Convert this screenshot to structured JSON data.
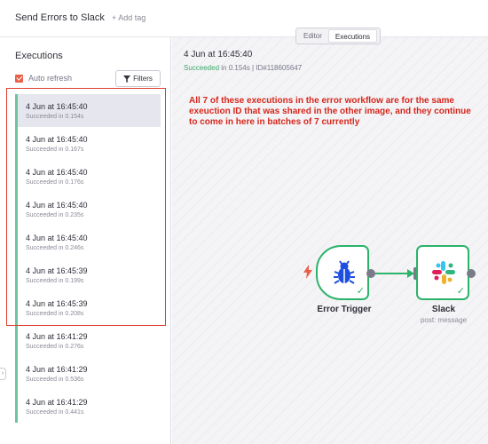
{
  "header": {
    "workflow_name": "Send Errors to Slack",
    "add_tag": "+ Add tag"
  },
  "view_toggle": {
    "editor": "Editor",
    "executions": "Executions",
    "active": "Executions"
  },
  "sidebar": {
    "title": "Executions",
    "auto_refresh": {
      "label": "Auto refresh",
      "checked": true
    },
    "filters_label": "Filters",
    "executions": [
      {
        "date": "4 Jun at 16:45:40",
        "status": "Succeeded in 0.154s",
        "selected": true
      },
      {
        "date": "4 Jun at 16:45:40",
        "status": "Succeeded in 0.167s"
      },
      {
        "date": "4 Jun at 16:45:40",
        "status": "Succeeded in 0.176s"
      },
      {
        "date": "4 Jun at 16:45:40",
        "status": "Succeeded in 0.235s"
      },
      {
        "date": "4 Jun at 16:45:40",
        "status": "Succeeded in 0.246s"
      },
      {
        "date": "4 Jun at 16:45:39",
        "status": "Succeeded in 0.199s"
      },
      {
        "date": "4 Jun at 16:45:39",
        "status": "Succeeded in 0.208s"
      },
      {
        "date": "4 Jun at 16:41:29",
        "status": "Succeeded in 0.276s"
      },
      {
        "date": "4 Jun at 16:41:29",
        "status": "Succeeded in 0.536s"
      },
      {
        "date": "4 Jun at 16:41:29",
        "status": "Succeeded in 0.441s"
      }
    ]
  },
  "execution_detail": {
    "date": "4 Jun at 16:45:40",
    "status": "Succeeded",
    "duration": "in 0.154s",
    "separator": "|",
    "id": "ID#118605647"
  },
  "annotation": "All 7 of these executions in the error workflow are for the same exeuction ID that was shared in the other image, and they continue to come in here in batches of 7 currently",
  "nodes": [
    {
      "name": "Error Trigger",
      "subtitle": "",
      "icon": "bug-icon",
      "color": "#1f4fe0"
    },
    {
      "name": "Slack",
      "subtitle": "post: message",
      "icon": "slack-icon"
    }
  ],
  "colors": {
    "success": "#2bb36a",
    "accent": "#ea5f4a",
    "annotation": "#d7261b"
  }
}
